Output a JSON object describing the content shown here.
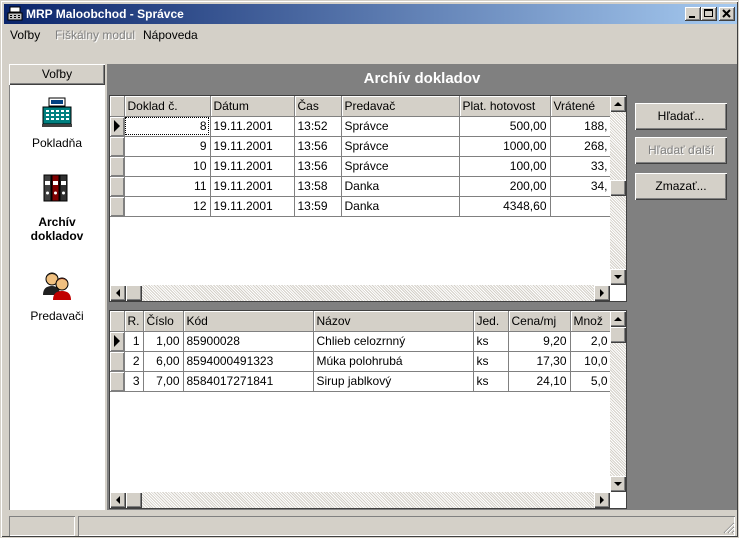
{
  "window": {
    "title": "MRP Maloobchod - Správce",
    "minimize": "minimize",
    "maximize": "maximize",
    "close": "close"
  },
  "menu": {
    "items": [
      {
        "label": "Voľby",
        "enabled": true
      },
      {
        "label": "Fiškálny modul",
        "enabled": false
      },
      {
        "label": "Nápoveda",
        "enabled": true
      }
    ]
  },
  "sidebar": {
    "header": "Voľby",
    "items": [
      {
        "label": "Pokladňa",
        "icon": "cash-register-icon",
        "active": false
      },
      {
        "label_line1": "Archív",
        "label_line2": "dokladov",
        "icon": "binders-icon",
        "active": true
      },
      {
        "label": "Predavači",
        "icon": "people-icon",
        "active": false
      }
    ]
  },
  "main": {
    "title": "Archív dokladov"
  },
  "receipts": {
    "columns": [
      "Doklad č.",
      "Dátum",
      "Čas",
      "Predavač",
      "Plat. hotovost",
      "Vrátené"
    ],
    "rows": [
      {
        "doklad": "8",
        "datum": "19.11.2001",
        "cas": "13:52",
        "predavac": "Správce",
        "plat": "500,00",
        "vratene": "188,"
      },
      {
        "doklad": "9",
        "datum": "19.11.2001",
        "cas": "13:56",
        "predavac": "Správce",
        "plat": "1000,00",
        "vratene": "268,"
      },
      {
        "doklad": "10",
        "datum": "19.11.2001",
        "cas": "13:56",
        "predavac": "Správce",
        "plat": "100,00",
        "vratene": "33,"
      },
      {
        "doklad": "11",
        "datum": "19.11.2001",
        "cas": "13:58",
        "predavac": "Danka",
        "plat": "200,00",
        "vratene": "34,"
      },
      {
        "doklad": "12",
        "datum": "19.11.2001",
        "cas": "13:59",
        "predavac": "Danka",
        "plat": "4348,60",
        "vratene": ""
      }
    ]
  },
  "items": {
    "columns": [
      "R.",
      "Číslo",
      "Kód",
      "Názov",
      "Jed.",
      "Cena/mj",
      "Množ"
    ],
    "rows": [
      {
        "r": "1",
        "cislo": "1,00",
        "kod": "85900028",
        "nazov": "Chlieb celozrnný",
        "jed": "ks",
        "cena": "9,20",
        "mnoz": "2,0"
      },
      {
        "r": "2",
        "cislo": "6,00",
        "kod": "8594000491323",
        "nazov": "Múka polohrubá",
        "jed": "ks",
        "cena": "17,30",
        "mnoz": "10,0"
      },
      {
        "r": "3",
        "cislo": "7,00",
        "kod": "8584017271841",
        "nazov": "Sirup jablkový",
        "jed": "ks",
        "cena": "24,10",
        "mnoz": "5,0"
      }
    ]
  },
  "actions": {
    "search": "Hľadať...",
    "search_next": "Hľadať ďalší",
    "delete": "Zmazať..."
  },
  "colors": {
    "title_gradient_start": "#0a246a",
    "title_gradient_end": "#a6caf0",
    "face": "#d4d0c8",
    "workspace": "#808080"
  }
}
